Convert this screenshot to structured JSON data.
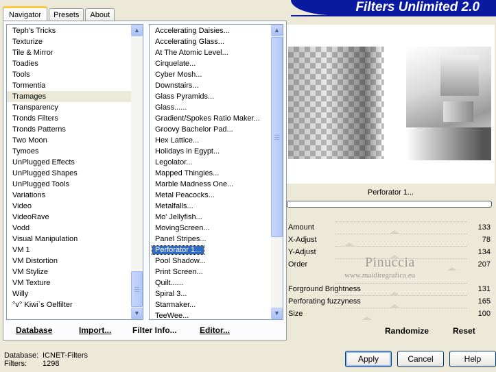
{
  "tabs": [
    "Navigator",
    "Presets",
    "About"
  ],
  "title": "Filters Unlimited 2.0",
  "categories": [
    "Teph's Tricks",
    "Texturize",
    "Tile & Mirror",
    "Toadies",
    "Tools",
    "Tormentia",
    "Tramages",
    "Transparency",
    "Tronds Filters",
    "Tronds Patterns",
    "Two Moon",
    "Tymoes",
    "UnPlugged Effects",
    "UnPlugged Shapes",
    "UnPlugged Tools",
    "Variations",
    "Video",
    "VideoRave",
    "Vodd",
    "Visual Manipulation",
    "VM 1",
    "VM Distortion",
    "VM Stylize",
    "VM Texture",
    "Willy",
    "°v° Kiwi`s Oelfilter"
  ],
  "selected_category": "Tramages",
  "filters": [
    "Accelerating Daisies...",
    "Accelerating Glass...",
    "At The Atomic Level...",
    "Cirquelate...",
    "Cyber Mosh...",
    "Downstairs...",
    "Glass Pyramids...",
    "Glass......",
    "Gradient/Spokes Ratio Maker...",
    "Groovy Bachelor Pad...",
    "Hex Lattice...",
    "Holidays in Egypt...",
    "Legolator...",
    "Mapped Thingies...",
    "Marble Madness One...",
    "Metal Peacocks...",
    "Metalfalls...",
    "Mo' Jellyfish...",
    "MovingScreen...",
    "Panel Stripes...",
    "Perforator 1...",
    "Pool Shadow...",
    "Print Screen...",
    "Quilt......",
    "Spiral 3...",
    "Starmaker...",
    "TeeWee..."
  ],
  "selected_filter": "Perforator 1...",
  "left_buttons": {
    "database": "Database",
    "import": "Import...",
    "filter_info": "Filter Info...",
    "editor": "Editor..."
  },
  "filter_name": "Perforator 1...",
  "params": [
    {
      "label": "Amount",
      "value": "133"
    },
    {
      "label": "X-Adjust",
      "value": "78"
    },
    {
      "label": "Y-Adjust",
      "value": "134"
    },
    {
      "label": "Order",
      "value": "207"
    },
    {
      "label": "",
      "value": ""
    },
    {
      "label": "Forground Brightness",
      "value": "131"
    },
    {
      "label": "Perforating fuzzyness",
      "value": "165"
    },
    {
      "label": "Size",
      "value": "100"
    }
  ],
  "right_buttons": {
    "randomize": "Randomize",
    "reset": "Reset"
  },
  "watermark": {
    "name": "Pinuccia",
    "site": "www.maidiregrafica.eu"
  },
  "status": {
    "database_label": "Database:",
    "database_value": "ICNET-Filters",
    "filters_label": "Filters:",
    "filters_value": "1298"
  },
  "dialog_buttons": {
    "apply": "Apply",
    "cancel": "Cancel",
    "help": "Help"
  },
  "colors": {
    "banner": "#0a1aa0",
    "selection": "#316ac5",
    "dialog_bg": "#ece9d8"
  }
}
